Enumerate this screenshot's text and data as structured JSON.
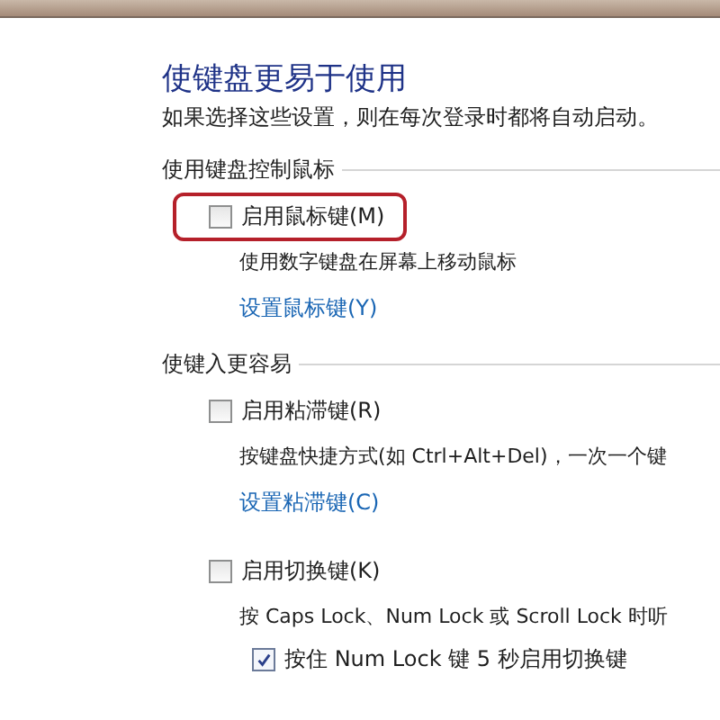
{
  "title": "使键盘更易于使用",
  "subtitle": "如果选择这些设置，则在每次登录时都将自动启动。",
  "sections": [
    {
      "label": "使用键盘控制鼠标",
      "options": [
        {
          "label": "启用鼠标键(M)",
          "checked": false,
          "highlighted": true,
          "description": "使用数字键盘在屏幕上移动鼠标",
          "link": "设置鼠标键(Y)"
        }
      ]
    },
    {
      "label": "使键入更容易",
      "options": [
        {
          "label": "启用粘滞键(R)",
          "checked": false,
          "highlighted": false,
          "description": "按键盘快捷方式(如 Ctrl+Alt+Del)，一次一个键",
          "link": "设置粘滞键(C)"
        },
        {
          "label": "启用切换键(K)",
          "checked": false,
          "highlighted": false,
          "description": "按 Caps Lock、Num Lock 或 Scroll Lock 时听",
          "suboption": {
            "label": "按住 Num Lock 键 5 秒启用切换键",
            "checked": true
          }
        }
      ]
    }
  ]
}
